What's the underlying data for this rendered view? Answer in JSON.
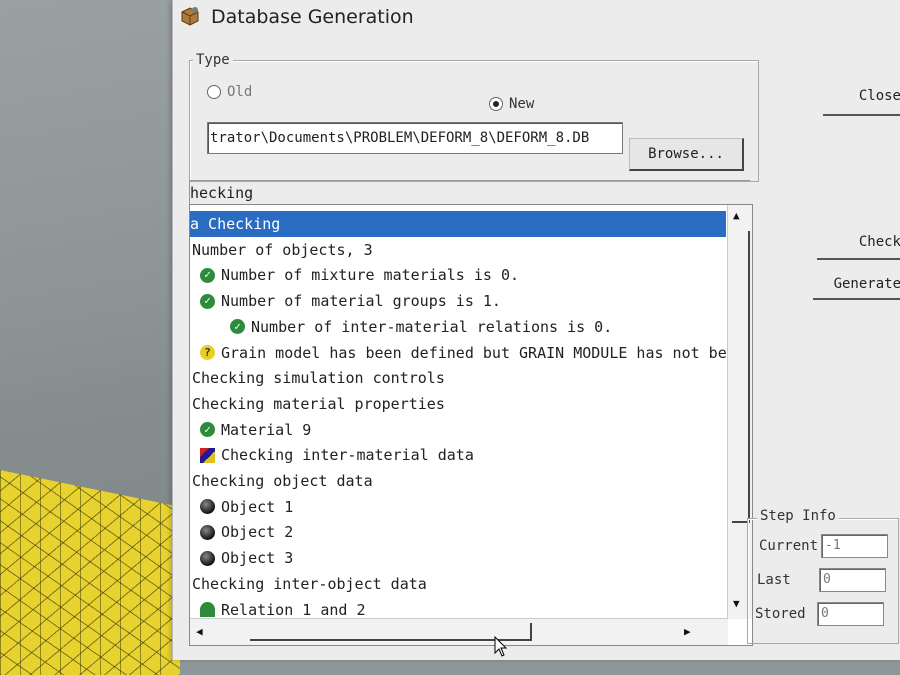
{
  "window": {
    "title": "Database Generation"
  },
  "type_group": {
    "legend": "Type",
    "old_label": "Old",
    "new_label": "New",
    "selected": "New",
    "path_value": "trator\\Documents\\PROBLEM\\DEFORM_8\\DEFORM_8.DB",
    "browse_label": "Browse..."
  },
  "buttons": {
    "close": "Close",
    "check": "Check",
    "generate": "Generate"
  },
  "list": {
    "header": "hecking",
    "rows": [
      {
        "text": "a Checking",
        "icon": "none",
        "selected": true
      },
      {
        "text": "Number of objects, 3",
        "icon": "none"
      },
      {
        "text": "Number of mixture materials is 0.",
        "icon": "check-icon"
      },
      {
        "text": "Number of material groups is 1.",
        "icon": "check-icon"
      },
      {
        "text": "Number of inter-material relations is 0.",
        "icon": "check-icon"
      },
      {
        "text": "Grain model has been defined but GRAIN MODULE has not bee",
        "icon": "question-icon"
      },
      {
        "text": "Checking simulation controls",
        "icon": "none"
      },
      {
        "text": "Checking material properties",
        "icon": "none"
      },
      {
        "text": "Material 9",
        "icon": "check-icon"
      },
      {
        "text": "Checking inter-material data",
        "icon": "multicolor-icon"
      },
      {
        "text": "Checking object data",
        "icon": "none"
      },
      {
        "text": "Object 1",
        "icon": "object-icon"
      },
      {
        "text": "Object 2",
        "icon": "object-icon"
      },
      {
        "text": "Object 3",
        "icon": "object-icon"
      },
      {
        "text": "Checking inter-object data",
        "icon": "none"
      },
      {
        "text": "Relation 1 and 2",
        "icon": "relation-icon"
      }
    ]
  },
  "step_info": {
    "legend": "Step Info",
    "current_label": "Current",
    "current_value": "-1",
    "last_label": "Last",
    "last_value": "0",
    "stored_label": "Stored",
    "stored_value": "0"
  }
}
